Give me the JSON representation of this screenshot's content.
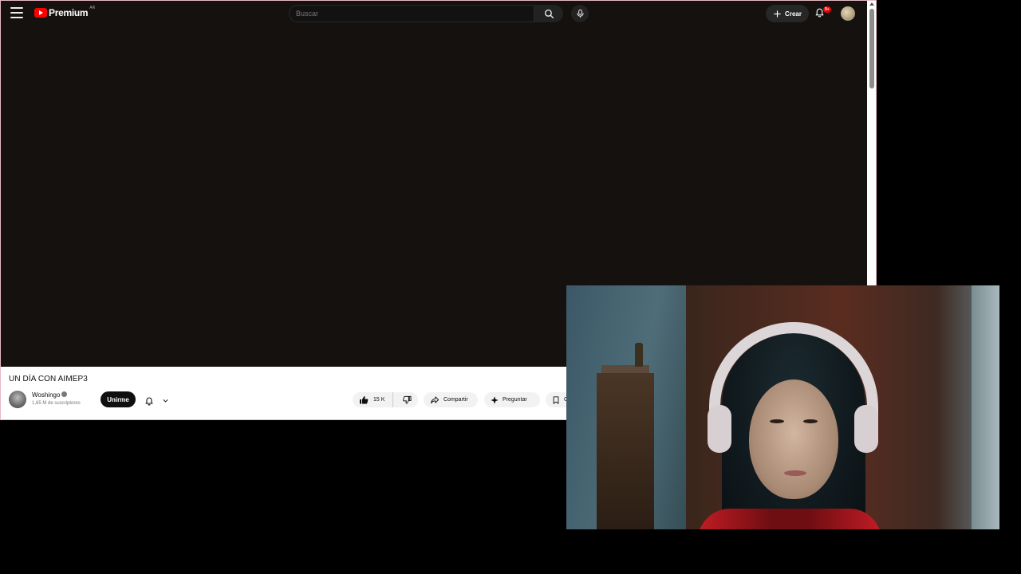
{
  "header": {
    "logo_text": "Premium",
    "logo_region": "AR",
    "search_placeholder": "Buscar",
    "create_label": "Crear",
    "notifications_badge": "9+"
  },
  "video": {
    "title": "UN DÍA CON AIMEP3",
    "channel_name": "Woshingo",
    "subscribers": "1,65 M de suscriptores",
    "join_label": "Unirme",
    "likes": "15 K",
    "share_label": "Compartir",
    "ask_label": "Preguntar",
    "save_label": "G"
  },
  "colors": {
    "brand_red": "#ff0000",
    "player_bg": "#14110f",
    "shirt_red": "#c21c24"
  },
  "icons": [
    "menu-icon",
    "youtube-logo-icon",
    "search-icon",
    "mic-icon",
    "plus-icon",
    "bell-icon",
    "avatar",
    "verified-icon",
    "thumbs-up-icon",
    "thumbs-down-icon",
    "share-icon",
    "sparkle-icon",
    "bookmark-icon",
    "chevron-down-icon"
  ]
}
